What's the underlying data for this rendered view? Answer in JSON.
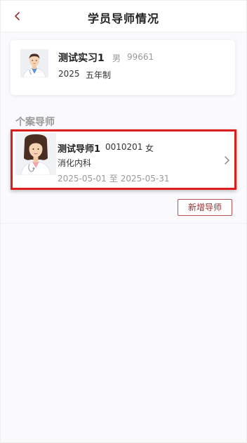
{
  "header": {
    "title": "学员导师情况",
    "back_icon": "chevron-left-icon"
  },
  "student": {
    "name": "测试实习1",
    "gender": "男",
    "id": "99661",
    "year": "2025",
    "program": "五年制",
    "avatar": "male-doctor-avatar"
  },
  "mentors_section": {
    "title": "个案导师",
    "items": [
      {
        "name": "测试导师1",
        "id": "0010201",
        "gender": "女",
        "department": "消化内科",
        "start_date": "2025-05-01",
        "separator": "至",
        "end_date": "2025-05-31",
        "avatar": "female-doctor-avatar"
      }
    ]
  },
  "actions": {
    "add_mentor_label": "新增导师"
  },
  "colors": {
    "accent": "#9c2f2f",
    "highlight_border": "#dd1c1c",
    "muted_text": "#999999"
  }
}
